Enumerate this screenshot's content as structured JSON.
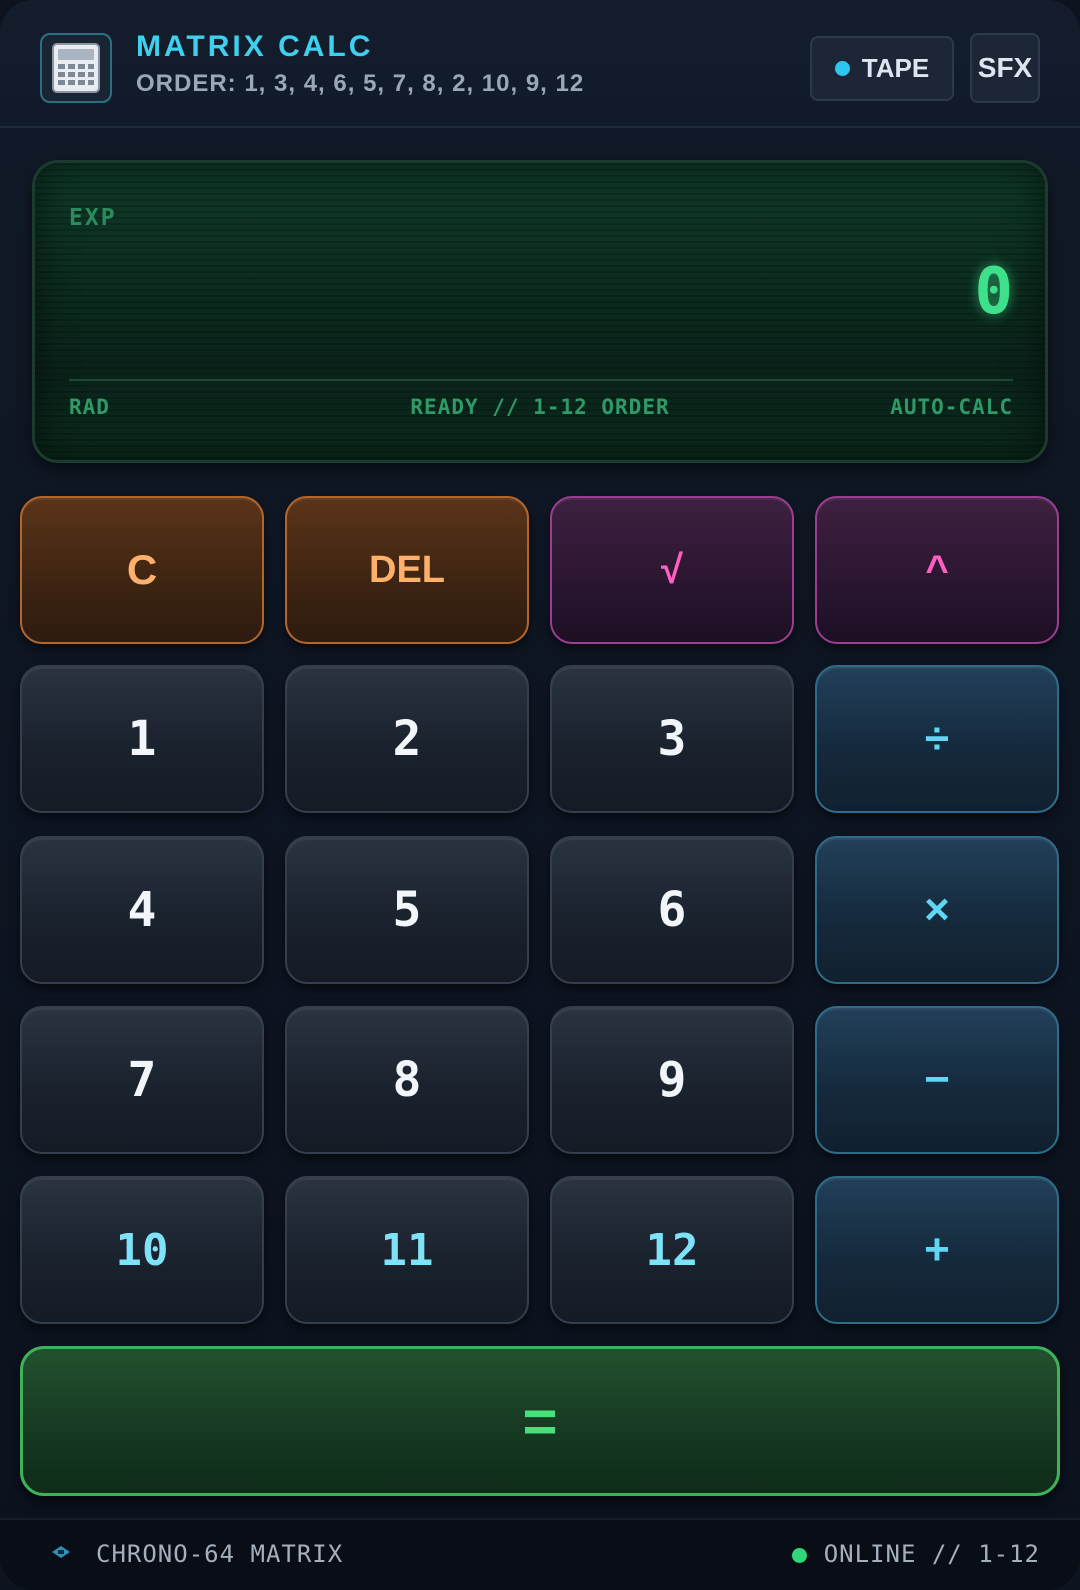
{
  "header": {
    "title": "MATRIX CALC",
    "subtitle": "ORDER: 1, 3, 4, 6, 5, 7, 8, 2, 10, 9, 12",
    "logo_icon": "calculator-icon",
    "tape_label": "TAPE",
    "sfx_label": "SFX"
  },
  "display": {
    "expression_label": "EXP",
    "value": "0",
    "mode": "RAD",
    "status": "READY // 1-12 ORDER",
    "calc_mode": "AUTO-CALC"
  },
  "keys": {
    "clear": "C",
    "delete": "DEL",
    "sqrt": "√",
    "power": "^",
    "k1": "1",
    "k2": "2",
    "k3": "3",
    "divide": "÷",
    "k4": "4",
    "k5": "5",
    "k6": "6",
    "multiply": "×",
    "k7": "7",
    "k8": "8",
    "k9": "9",
    "subtract": "−",
    "k10": "10",
    "k11": "11",
    "k12": "12",
    "add": "+",
    "equals": "="
  },
  "footer": {
    "device": "CHRONO-64 MATRIX",
    "status": "ONLINE // 1-12"
  },
  "colors": {
    "accent_cyan": "#3fd0ef",
    "display_green": "#3fe08c",
    "clear_orange": "#ffb06a",
    "function_pink": "#ff5fc0",
    "equals_green": "#47e07a",
    "online_dot": "#2fd67a"
  }
}
